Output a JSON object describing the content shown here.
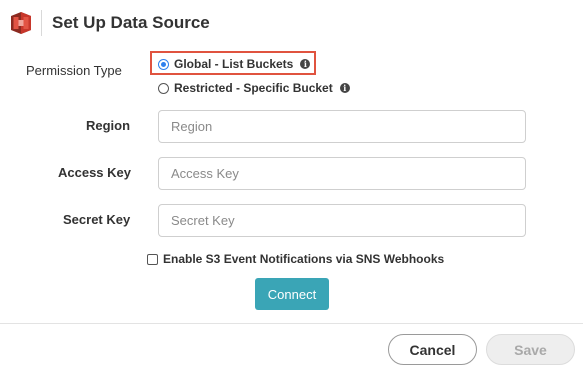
{
  "dialog": {
    "title": "Set Up Data Source",
    "logo_icon": "s3-bucket-icon",
    "logo_color": "#c7372b"
  },
  "permission": {
    "label": "Permission Type",
    "options": [
      {
        "label": "Global - List Buckets",
        "selected": true,
        "icon": "info-icon"
      },
      {
        "label": "Restricted - Specific Bucket",
        "selected": false,
        "icon": "info-icon"
      }
    ],
    "highlight_color": "#e0533f"
  },
  "fields": {
    "region": {
      "label": "Region",
      "placeholder": "Region",
      "value": ""
    },
    "access_key": {
      "label": "Access Key",
      "placeholder": "Access Key",
      "value": ""
    },
    "secret_key": {
      "label": "Secret Key",
      "placeholder": "Secret Key",
      "value": ""
    }
  },
  "sns": {
    "label": "Enable S3 Event Notifications via SNS Webhooks",
    "checked": false
  },
  "buttons": {
    "connect": "Connect",
    "cancel": "Cancel",
    "save": "Save",
    "accent_color": "#3aa5b6"
  }
}
